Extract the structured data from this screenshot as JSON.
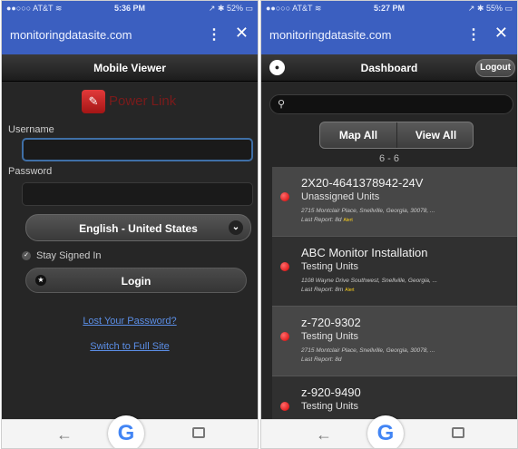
{
  "left_phone": {
    "status_bar": {
      "carrier": "●●○○○ AT&T ≋",
      "time": "5:36 PM",
      "battery": "↗ ✱ 52% ▭"
    },
    "browser": {
      "url": "monitoringdatasite.com",
      "menu_icon": "⋮",
      "close_icon": "✕"
    },
    "header": {
      "title": "Mobile Viewer"
    },
    "logo": {
      "glyph": "✎",
      "text": "Power Link"
    },
    "username": {
      "label": "Username",
      "value": ""
    },
    "password": {
      "label": "Password",
      "value": ""
    },
    "language": {
      "selected": "English - United States",
      "chevron": "⌄"
    },
    "stay_signed_in": {
      "label": "Stay Signed In",
      "check": "✓"
    },
    "login": {
      "label": "Login",
      "icon": "★"
    },
    "links": {
      "lost_password": "Lost Your Password?",
      "full_site": "Switch to Full Site"
    },
    "nav": {
      "back": "←",
      "google": "G"
    }
  },
  "right_phone": {
    "status_bar": {
      "carrier": "●●○○○ AT&T ≋",
      "time": "5:27 PM",
      "battery": "↗ ✱ 55% ▭"
    },
    "browser": {
      "url": "monitoringdatasite.com",
      "menu_icon": "⋮",
      "close_icon": "✕"
    },
    "header": {
      "title": "Dashboard",
      "home_icon": "●",
      "logout_label": "Logout"
    },
    "search": {
      "icon": "⚲",
      "placeholder": ""
    },
    "buttons": {
      "map_all": "Map All",
      "view_all": "View All"
    },
    "count": "6 - 6",
    "units": [
      {
        "name": "2X20-4641378942-24V",
        "group": "Unassigned Units",
        "address": "2715 Montclair Place, Snellville, Georgia, 30078, ...",
        "report": "Last Report: 8d",
        "alert": "Alert"
      },
      {
        "name": "ABC Monitor Installation",
        "group": "Testing Units",
        "address": "1108 Wayne Drive Southwest, Snellville, Georgia, ...",
        "report": "Last Report: 8m",
        "alert": "Alert"
      },
      {
        "name": "z-720-9302",
        "group": "Testing Units",
        "address": "2715 Montclair Place, Snellville, Georgia, 30078, ...",
        "report": "Last Report: 8d",
        "alert": ""
      },
      {
        "name": "z-920-9490",
        "group": "Testing Units",
        "address": "",
        "report": "",
        "alert": ""
      }
    ],
    "nav": {
      "back": "←",
      "google": "G"
    }
  },
  "colors": {
    "browser_bar": "#3b5fc0",
    "app_bg": "#262626",
    "link": "#5b8ee6",
    "status_dot": "#d40000",
    "alert_tag": "#ffd21c"
  }
}
